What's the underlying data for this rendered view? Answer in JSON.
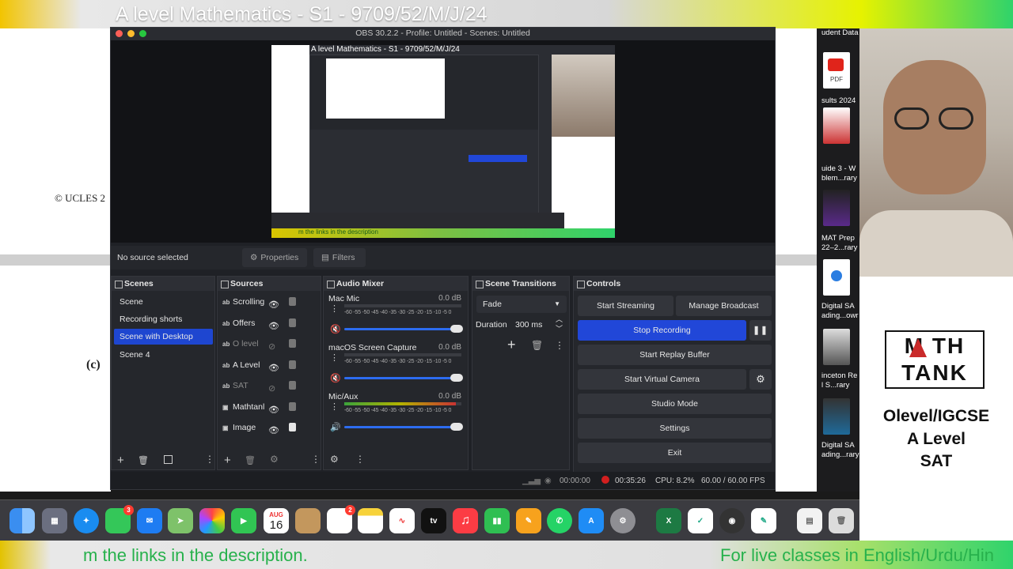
{
  "slide": {
    "title": "A level Mathematics - S1 - 9709/52/M/J/24",
    "copyright": "© UCLES 2",
    "part_label": "(c)",
    "banner_left": "m the links in the description.",
    "banner_right": "For live classes in English/Urdu/Hin"
  },
  "files": [
    "udent Data",
    "PDF",
    "sults 2024",
    "uide 3 - W",
    "blem...rary",
    "MAT Prep",
    "22–2...rary",
    "Digital SA",
    "ading...owr",
    "inceton Re",
    "l S...rary",
    "Digital SA",
    "ading...rary"
  ],
  "brand": {
    "logo_line1": "M TH",
    "logo_line2": "TANK",
    "line1": "Olevel/IGCSE",
    "line2": "A Level",
    "line3": "SAT"
  },
  "obs": {
    "window_title": "OBS 30.2.2 - Profile: Untitled - Scenes: Untitled",
    "preview": {
      "title": "A level Mathematics - S1 - 9709/52/M/J/24",
      "banner": "m the links in the description"
    },
    "source_bar": {
      "no_source": "No source selected",
      "properties": "Properties",
      "filters": "Filters"
    },
    "scenes": {
      "header": "Scenes",
      "items": [
        "Scene",
        "Recording shorts",
        "Scene with Desktop",
        "Scene 4"
      ],
      "active_index": 2
    },
    "sources": {
      "header": "Sources",
      "items": [
        {
          "type": "ab",
          "name": "Scrolling",
          "visible": true
        },
        {
          "type": "ab",
          "name": "Offers",
          "visible": true
        },
        {
          "type": "ab",
          "name": "O level",
          "visible": false
        },
        {
          "type": "ab",
          "name": "A Level",
          "visible": true
        },
        {
          "type": "ab",
          "name": "SAT",
          "visible": false
        },
        {
          "type": "img",
          "name": "Mathtanl",
          "visible": true
        },
        {
          "type": "img",
          "name": "Image",
          "visible": true
        }
      ]
    },
    "mixer": {
      "header": "Audio Mixer",
      "ticks": "-60 -55 -50 -45 -40 -35 -30 -25 -20 -15 -10 -5  0",
      "channels": [
        {
          "name": "Mac Mic",
          "db": "0.0 dB",
          "level": 0.0,
          "muted": true
        },
        {
          "name": "macOS Screen Capture",
          "db": "0.0 dB",
          "level": 0.0,
          "muted": true
        },
        {
          "name": "Mic/Aux",
          "db": "0.0 dB",
          "level": 0.95,
          "muted": false
        }
      ]
    },
    "transitions": {
      "header": "Scene Transitions",
      "selected": "Fade",
      "duration_label": "Duration",
      "duration_value": "300 ms"
    },
    "controls": {
      "header": "Controls",
      "start_streaming": "Start Streaming",
      "manage_broadcast": "Manage Broadcast",
      "stop_recording": "Stop Recording",
      "start_replay": "Start Replay Buffer",
      "start_virtual": "Start Virtual Camera",
      "studio_mode": "Studio Mode",
      "settings": "Settings",
      "exit": "Exit"
    },
    "status": {
      "stream_time": "00:00:00",
      "rec_time": "00:35:26",
      "cpu": "CPU: 8.2%",
      "fps": "60.00 / 60.00 FPS"
    }
  },
  "dock": {
    "calendar_month": "AUG",
    "calendar_day": "16",
    "messages_badge": "3",
    "reminders_badge": "2",
    "tv_label": "tv"
  },
  "colors": {
    "obs_bg": "#1f2126",
    "rec_button": "#2147d8",
    "active_scene": "#1e46d0",
    "banner_text": "#27b14c"
  }
}
